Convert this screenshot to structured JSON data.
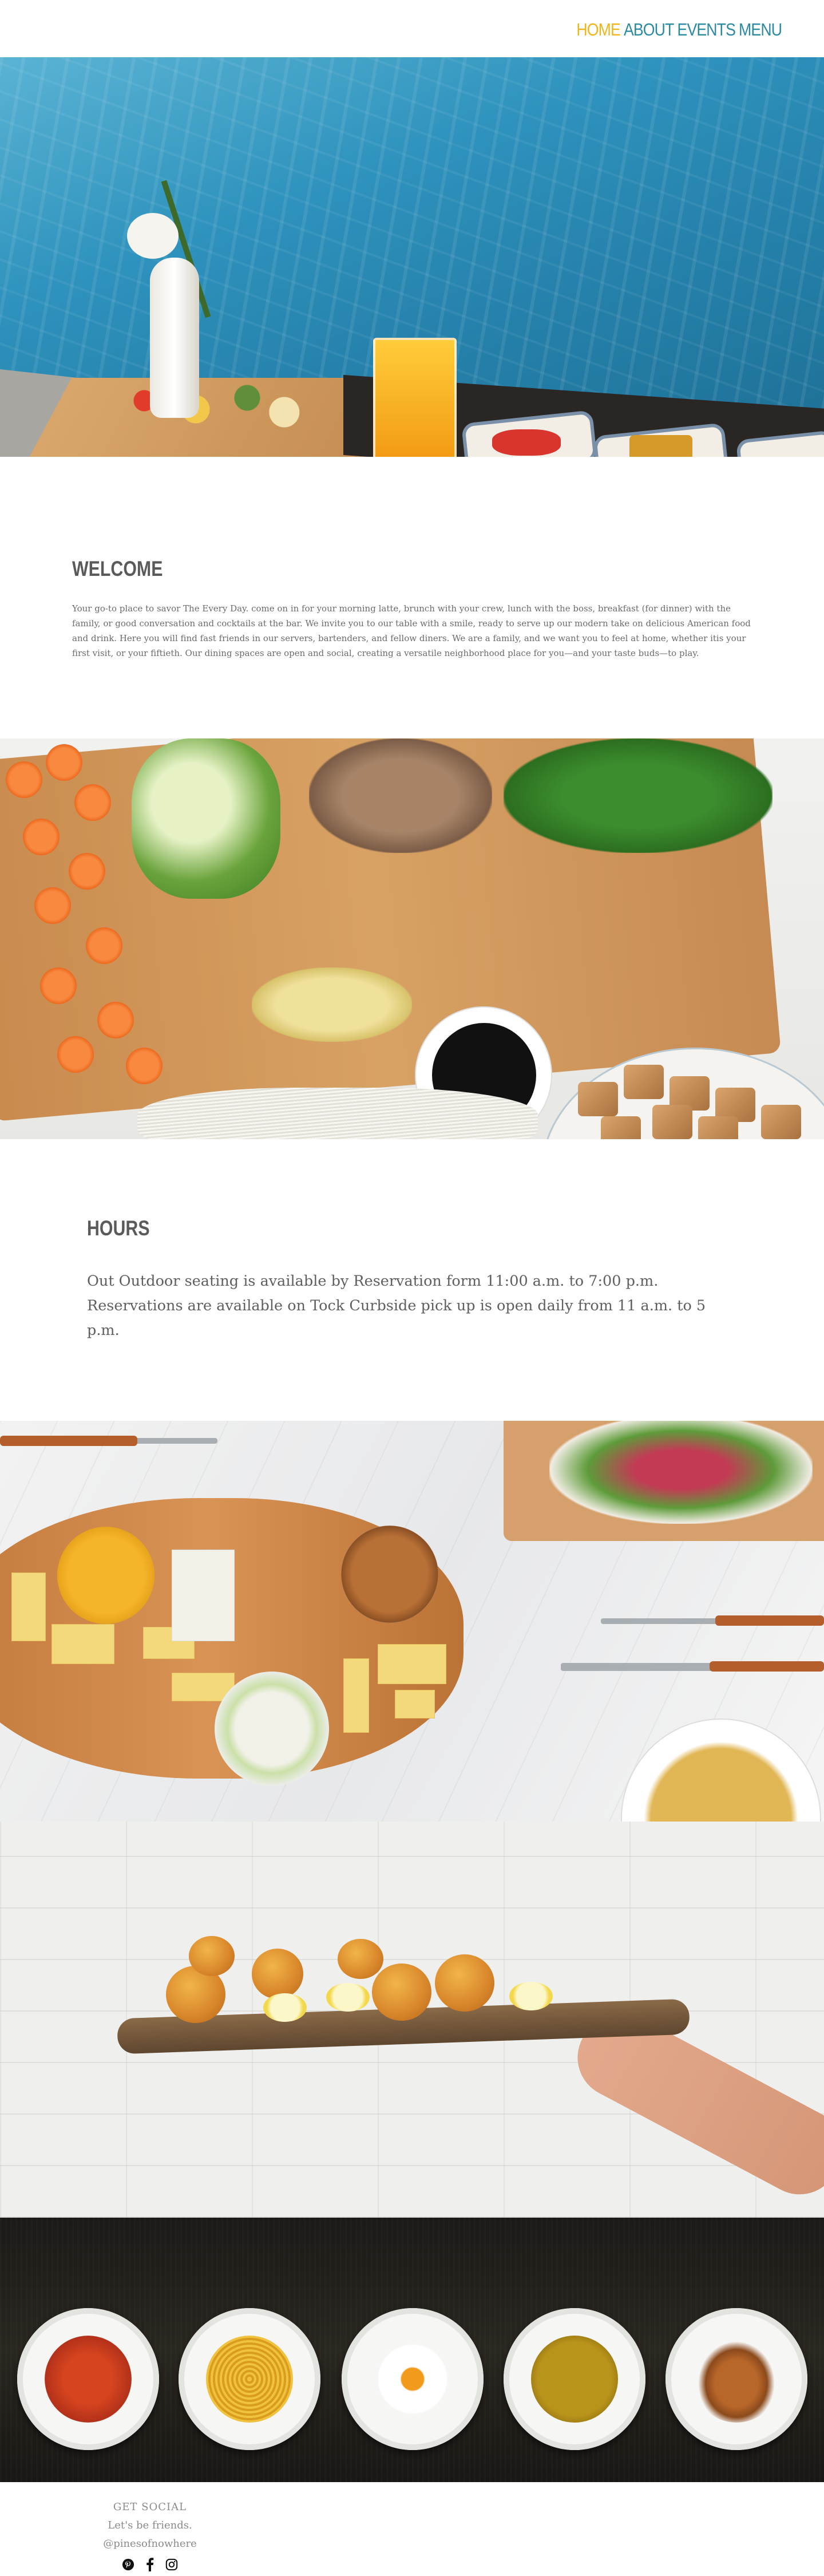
{
  "nav": {
    "items": [
      {
        "label": "HOME",
        "active": true
      },
      {
        "label": "ABOUT"
      },
      {
        "label": "EVENTS"
      },
      {
        "label": "MENU"
      }
    ],
    "active_color": "#f0b51a",
    "link_color": "#2a8aa3"
  },
  "welcome": {
    "title": "WELCOME",
    "body": "Your go-to place to savor The Every Day. come on in for your morning latte, brunch with your crew, lunch with the boss, breakfast (for dinner) with the family, or good conversation and cocktails at the bar. We invite you to our table with a smile, ready to serve up our modern take on delicious American food and drink. Here you will find fast friends in our servers, bartenders, and fellow diners. We are a family, and we want you to feel at home, whether itis your first visit, or your fiftieth. Our dining spaces are open and social, creating a versatile neighborhood place for you—and your taste buds—to play."
  },
  "hours": {
    "title": "HOURS",
    "line1": "Out Outdoor seating is available by Reservation form 11:00 a.m. to 7:00 p.m.",
    "line2": "Reservations are available on Tock Curbside pick up is open daily from 11 a.m. to 5 p.m."
  },
  "footer": {
    "title": "GET SOCIAL",
    "handle": "Let's be friends. @pinesofnowhere",
    "icons": [
      "pinterest-icon",
      "facebook-icon",
      "instagram-icon"
    ]
  }
}
